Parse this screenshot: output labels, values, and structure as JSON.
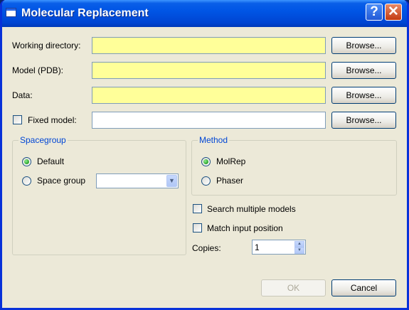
{
  "window": {
    "title": "Molecular Replacement",
    "help_glyph": "?",
    "close_glyph": "✕"
  },
  "form": {
    "working_directory": {
      "label": "Working directory:",
      "value": "",
      "browse_label": "Browse..."
    },
    "model": {
      "label": "Model (PDB):",
      "value": "",
      "browse_label": "Browse..."
    },
    "data": {
      "label": "Data:",
      "value": "",
      "browse_label": "Browse..."
    },
    "fixed_model": {
      "label": "Fixed model:",
      "checked": false,
      "value": "",
      "browse_label": "Browse..."
    }
  },
  "spacegroup": {
    "title": "Spacegroup",
    "options": [
      {
        "label": "Default",
        "selected": true
      },
      {
        "label": "Space group",
        "selected": false
      }
    ],
    "combo_value": ""
  },
  "method": {
    "title": "Method",
    "options": [
      {
        "label": "MolRep",
        "selected": true
      },
      {
        "label": "Phaser",
        "selected": false
      }
    ]
  },
  "options": {
    "search_multiple": {
      "label": "Search multiple models",
      "checked": false
    },
    "match_input": {
      "label": "Match input position",
      "checked": false
    }
  },
  "copies": {
    "label": "Copies:",
    "value": "1"
  },
  "footer": {
    "ok_label": "OK",
    "cancel_label": "Cancel"
  },
  "colors": {
    "required_field": "#ffff99",
    "group_title": "#0046d5",
    "titlebar": "#0055e5"
  }
}
